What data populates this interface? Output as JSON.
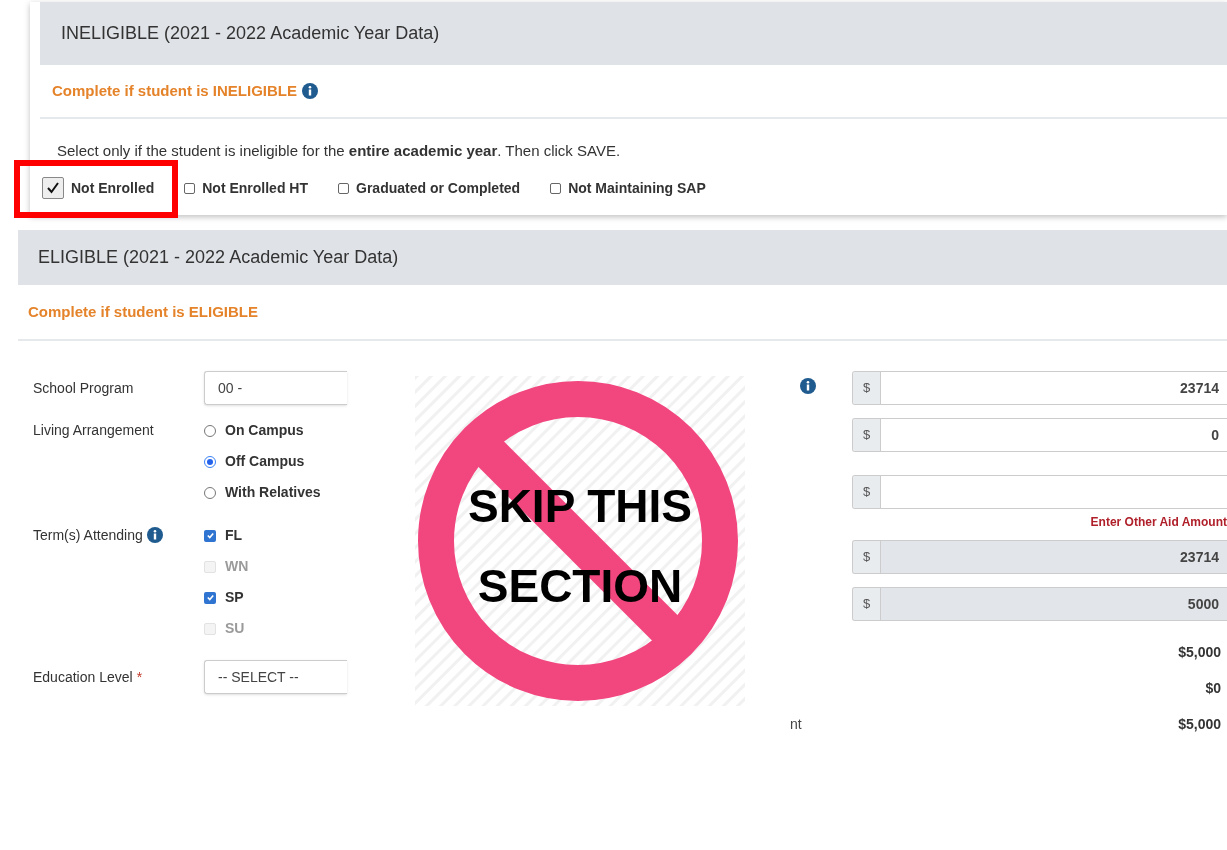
{
  "ineligible": {
    "title": "INELIGIBLE (2021 - 2022 Academic Year Data)",
    "subtitle": "Complete if student is INELIGIBLE",
    "subtitle_info": true,
    "instruction": "Select only if the student is ineligible for the **entire academic year**. Then click SAVE.",
    "options": [
      {
        "label": "Not Enrolled",
        "checked": true,
        "highlighted": true
      },
      {
        "label": "Not Enrolled HT",
        "checked": false,
        "highlighted": false
      },
      {
        "label": "Graduated or Completed",
        "checked": false,
        "highlighted": false
      },
      {
        "label": "Not Maintaining SAP",
        "checked": false,
        "highlighted": false
      }
    ]
  },
  "eligible": {
    "title": "ELIGIBLE (2021 - 2022 Academic Year Data)",
    "subtitle": "Complete if student is ELIGIBLE",
    "fields": [
      {
        "kind": "select",
        "label": "School Program",
        "value": "00 -"
      },
      {
        "kind": "radio",
        "label": "Living Arrangement",
        "options": [
          {
            "label": "On Campus",
            "selected": false
          },
          {
            "label": "Off Campus",
            "selected": true
          },
          {
            "label": "With Relatives",
            "selected": false
          }
        ]
      },
      {
        "kind": "checkbox",
        "label": "Term(s) Attending",
        "info": true,
        "options": [
          {
            "label": "FL",
            "checked": true,
            "disabled": false
          },
          {
            "label": "WN",
            "checked": false,
            "disabled": true
          },
          {
            "label": "SP",
            "checked": true,
            "disabled": false
          },
          {
            "label": "SU",
            "checked": false,
            "disabled": true
          }
        ]
      },
      {
        "kind": "select",
        "label": "Education Level",
        "marker": "*",
        "value": "-- SELECT --"
      }
    ],
    "amounts": [
      {
        "kind": "currency",
        "prefix": "$",
        "value": "23714",
        "readonly": false,
        "info": true
      },
      {
        "kind": "currency",
        "prefix": "$",
        "value": "0",
        "readonly": false
      },
      {
        "kind": "currency",
        "prefix": "$",
        "readonly": false,
        "error": "Enter Other Aid Amount"
      },
      {
        "kind": "currency",
        "prefix": "$",
        "value": "23714",
        "readonly": true
      },
      {
        "kind": "currency",
        "prefix": "$",
        "value": "5000",
        "readonly": true
      },
      {
        "kind": "total",
        "value": "$5,000"
      },
      {
        "kind": "total",
        "value": "$0"
      },
      {
        "kind": "total",
        "label": "nt",
        "value": "$5,000"
      }
    ]
  },
  "overlay": {
    "lines": [
      "SKIP THIS",
      "SECTION"
    ]
  }
}
